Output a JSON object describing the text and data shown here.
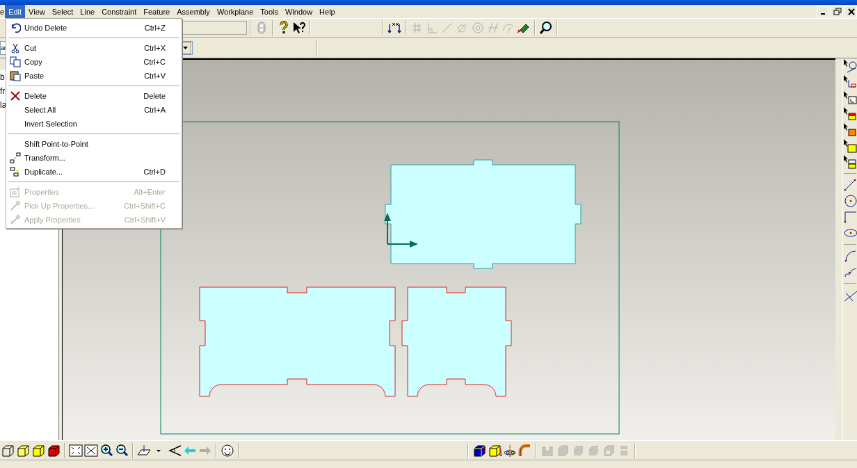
{
  "menubar": {
    "items": [
      {
        "label": "e",
        "selected": false
      },
      {
        "label": "Edit",
        "selected": true
      },
      {
        "label": "View",
        "selected": false
      },
      {
        "label": "Select",
        "selected": false
      },
      {
        "label": "Line",
        "selected": false
      },
      {
        "label": "Constraint",
        "selected": false
      },
      {
        "label": "Feature",
        "selected": false
      },
      {
        "label": "Assembly",
        "selected": false
      },
      {
        "label": "Workplane",
        "selected": false
      },
      {
        "label": "Tools",
        "selected": false
      },
      {
        "label": "Window",
        "selected": false
      },
      {
        "label": "Help",
        "selected": false
      }
    ]
  },
  "edit_menu": {
    "items": [
      {
        "kind": "item",
        "label": "Undo Delete",
        "shortcut": "Ctrl+Z",
        "disabled": false
      },
      {
        "kind": "separator"
      },
      {
        "kind": "item",
        "label": "Cut",
        "shortcut": "Ctrl+X",
        "disabled": false
      },
      {
        "kind": "item",
        "label": "Copy",
        "shortcut": "Ctrl+C",
        "disabled": false
      },
      {
        "kind": "item",
        "label": "Paste",
        "shortcut": "Ctrl+V",
        "disabled": false
      },
      {
        "kind": "separator"
      },
      {
        "kind": "item",
        "label": "Delete",
        "shortcut": "Delete",
        "disabled": false
      },
      {
        "kind": "item",
        "label": "Select All",
        "shortcut": "Ctrl+A",
        "disabled": false
      },
      {
        "kind": "item",
        "label": "Invert Selection",
        "disabled": false
      },
      {
        "kind": "separator"
      },
      {
        "kind": "item",
        "label": "Shift Point-to-Point",
        "disabled": false
      },
      {
        "kind": "item",
        "label": "Transform...",
        "disabled": false
      },
      {
        "kind": "item",
        "label": "Duplicate...",
        "shortcut": "Ctrl+D",
        "disabled": false
      },
      {
        "kind": "separator"
      },
      {
        "kind": "item",
        "label": "Properties",
        "shortcut": "Alt+Enter",
        "disabled": true
      },
      {
        "kind": "item",
        "label": "Pick Up Properties...",
        "shortcut": "Ctrl+Shift+C",
        "disabled": true
      },
      {
        "kind": "item",
        "label": "Apply Properties",
        "shortcut": "Ctrl+Shift+V",
        "disabled": true
      }
    ]
  },
  "combo": {
    "value": "ar"
  },
  "left_panel": {
    "lines": [
      "b",
      "fr",
      "la"
    ]
  }
}
